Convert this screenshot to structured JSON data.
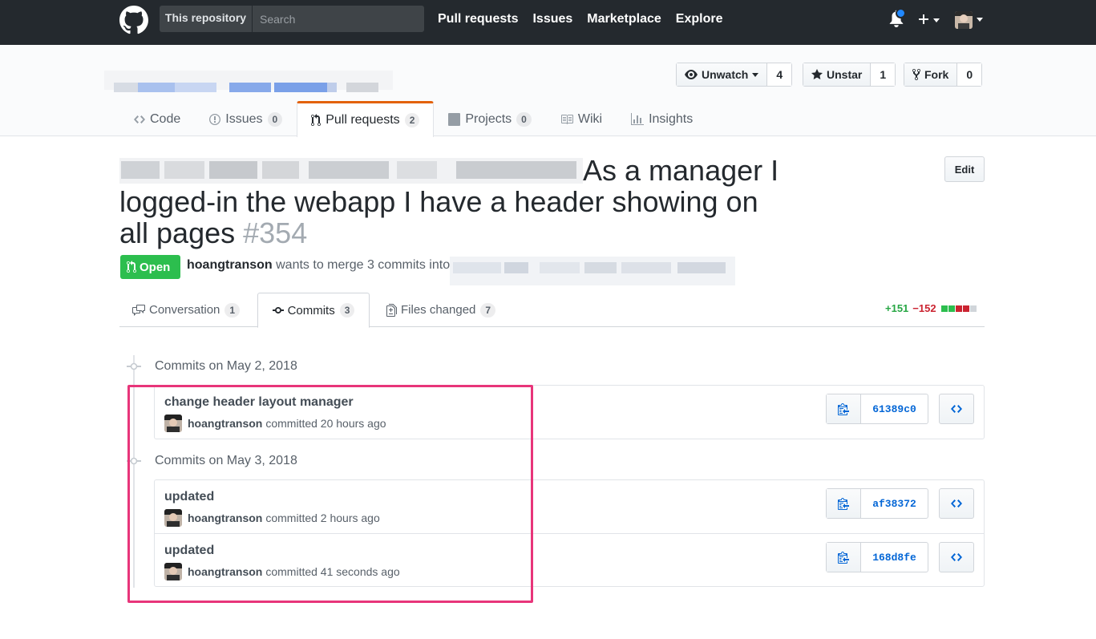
{
  "header": {
    "scope_label": "This repository",
    "search_placeholder": "Search",
    "nav": [
      "Pull requests",
      "Issues",
      "Marketplace",
      "Explore"
    ],
    "notification_dot_color": "#2188ff"
  },
  "repo_actions": {
    "watch_label": "Unwatch",
    "watch_count": "4",
    "star_label": "Unstar",
    "star_count": "1",
    "fork_label": "Fork",
    "fork_count": "0"
  },
  "repo_nav": {
    "code": "Code",
    "issues": "Issues",
    "issues_count": "0",
    "pulls": "Pull requests",
    "pulls_count": "2",
    "projects": "Projects",
    "projects_count": "0",
    "wiki": "Wiki",
    "insights": "Insights"
  },
  "pr": {
    "title": "As a manager I logged-in the webapp I have a header showing on all pages",
    "number": "#354",
    "edit_label": "Edit",
    "state": "Open",
    "author": "hoangtranson",
    "merge_text": "wants to merge 3 commits into"
  },
  "pr_tabs": {
    "conversation": "Conversation",
    "conversation_count": "1",
    "commits": "Commits",
    "commits_count": "3",
    "files": "Files changed",
    "files_count": "7"
  },
  "diffstat": {
    "additions": "+151",
    "deletions": "−152",
    "add_color": "#28a745",
    "del_color": "#cb2431"
  },
  "commit_groups": [
    {
      "title": "Commits on May 2, 2018",
      "commits": [
        {
          "message": "change header layout manager",
          "author": "hoangtranson",
          "time": "committed 20 hours ago",
          "sha": "61389c0"
        }
      ]
    },
    {
      "title": "Commits on May 3, 2018",
      "commits": [
        {
          "message": "updated",
          "author": "hoangtranson",
          "time": "committed 2 hours ago",
          "sha": "af38372"
        },
        {
          "message": "updated",
          "author": "hoangtranson",
          "time": "committed 41 seconds ago",
          "sha": "168d8fe"
        }
      ]
    }
  ],
  "colors": {
    "accent_tab": "#e36209",
    "open_green": "#2cbe4e",
    "highlight": "#e8357a",
    "link": "#0366d6"
  }
}
